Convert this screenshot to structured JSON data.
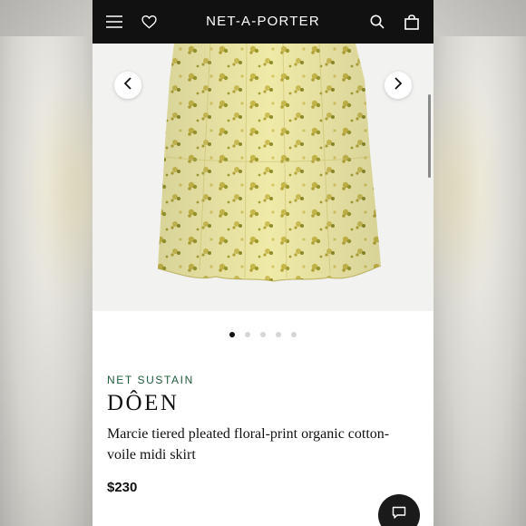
{
  "header": {
    "brand": "NET-A-PORTER",
    "icons": [
      "menu-icon",
      "heart-icon",
      "search-icon",
      "bag-icon"
    ]
  },
  "gallery": {
    "image_count": 5,
    "active_index": 0
  },
  "product": {
    "label": "NET SUSTAIN",
    "designer": "DÔEN",
    "name": "Marcie tiered pleated floral-print organic cotton-voile midi skirt",
    "price": "$230"
  },
  "colors": {
    "header_bg": "#111111",
    "sustain_green": "#1e5c3a",
    "skirt_base": "#f0eaa8",
    "print": "#b5a63a"
  }
}
